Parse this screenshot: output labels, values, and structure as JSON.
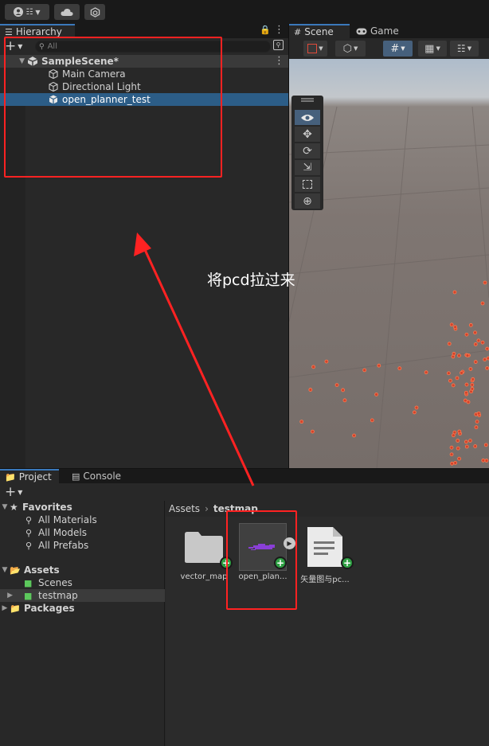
{
  "toolbar": {
    "account_icon": "account-icon",
    "cloud_icon": "cloud-icon",
    "package_icon": "package-icon"
  },
  "hierarchy": {
    "tab_label": "Hierarchy",
    "search_placeholder": "All",
    "scene_name": "SampleScene*",
    "items": [
      {
        "label": "Main Camera",
        "icon": "gameobject-cube-icon"
      },
      {
        "label": "Directional Light",
        "icon": "gameobject-cube-icon"
      },
      {
        "label": "open_planner_test",
        "icon": "prefab-cube-icon",
        "selected": true
      }
    ]
  },
  "scene": {
    "tabs": [
      {
        "label": "Scene",
        "icon": "grid-icon",
        "active": true
      },
      {
        "label": "Game",
        "icon": "gamepad-icon",
        "active": false
      }
    ],
    "tools": [
      "view-eye-icon",
      "move-icon",
      "rotate-icon",
      "scale-icon",
      "rect-icon",
      "transform-icon"
    ]
  },
  "project": {
    "tabs": [
      {
        "label": "Project",
        "icon": "folder-icon",
        "active": true
      },
      {
        "label": "Console",
        "icon": "console-icon",
        "active": false
      }
    ],
    "favorites": {
      "label": "Favorites",
      "items": [
        "All Materials",
        "All Models",
        "All Prefabs"
      ]
    },
    "assets": {
      "label": "Assets",
      "items": [
        "Scenes",
        "testmap"
      ]
    },
    "packages_label": "Packages",
    "breadcrumb": {
      "root": "Assets",
      "current": "testmap"
    },
    "files": [
      {
        "label": "vector_map",
        "kind": "folder"
      },
      {
        "label": "open_plan...",
        "kind": "model"
      },
      {
        "label": "矢量图与pc...",
        "kind": "text-document"
      }
    ]
  },
  "annotation": {
    "text": "将pcd拉过来",
    "color": "#ff2222"
  }
}
